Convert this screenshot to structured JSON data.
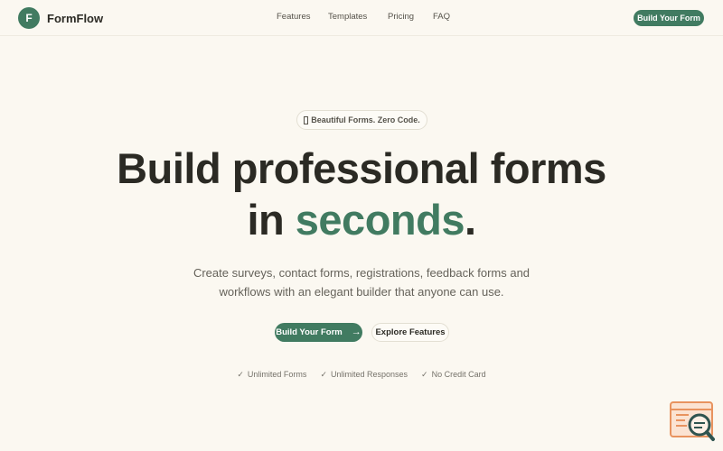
{
  "brand": {
    "logo_letter": "F",
    "name": "FormFlow"
  },
  "nav": {
    "links": [
      "Features",
      "Templates",
      "Pricing",
      "FAQ"
    ],
    "cta_label": "Build Your Form"
  },
  "hero": {
    "badge_text": "Beautiful Forms. Zero Code.",
    "headline_line1": "Build professional forms",
    "headline_line2_pre": "in ",
    "headline_accent": "seconds",
    "headline_post": ".",
    "subtitle": "Create surveys, contact forms, registrations, feedback forms and workflows with an elegant builder that anyone can use.",
    "primary_cta": "Build Your Form",
    "secondary_cta": "Explore Features",
    "features": [
      "Unlimited Forms",
      "Unlimited Responses",
      "No Credit Card"
    ]
  },
  "colors": {
    "background": "#fbf8f1",
    "accent": "#417b61",
    "text": "#2b2a24",
    "muted": "#65625a",
    "widget_orange": "#e8935f",
    "widget_dark": "#2f5450"
  },
  "icons": {
    "badge": "sparkle-icon",
    "primary_cta": "arrow-right-icon",
    "features": "check-icon",
    "widget": "feedback-search-icon"
  }
}
